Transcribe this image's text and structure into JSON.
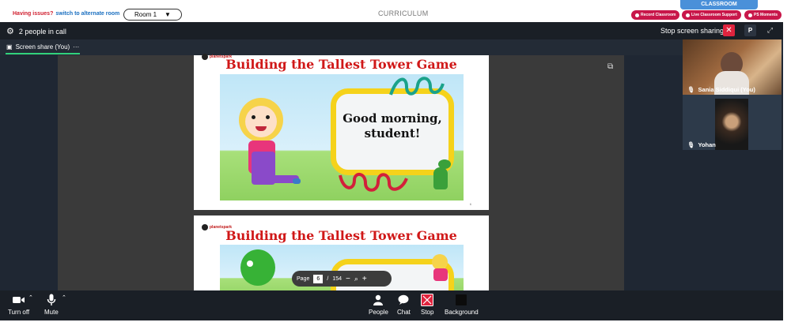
{
  "topbar": {
    "issue_text": "Having issues?",
    "alt_link": "switch to alternate room",
    "room_selected": "Room 1",
    "curriculum": "CURRICULUM",
    "classroom_tab": "CLASSROOM",
    "buttons": [
      "Record Classroom",
      "Live Classroom Support",
      "PS Moments"
    ]
  },
  "meeting": {
    "people_in_call": "2 people in call",
    "stop_sharing": "Stop screen sharing",
    "p_label": "P",
    "share_tab": "Screen share (You)",
    "share_more": "···"
  },
  "slides": [
    {
      "brand": "planetspark",
      "title": "Building the Tallest Tower Game",
      "greeting_line1": "Good morning,",
      "greeting_line2": "student!",
      "page_label": "6"
    },
    {
      "brand": "planetspark",
      "title": "Building the Tallest Tower Game"
    }
  ],
  "pager": {
    "label": "Page",
    "current": "6",
    "separator": "/",
    "total": "154"
  },
  "participants": [
    {
      "name": "Sania Siddiqui (You)"
    },
    {
      "name": "Yohan"
    }
  ],
  "toolbar": {
    "turn_off": "Turn off",
    "mute": "Mute",
    "people": "People",
    "chat": "Chat",
    "stop": "Stop",
    "background": "Background"
  },
  "colors": {
    "accent_red": "#e0243e",
    "share_underline": "#31d27c",
    "classroom_blue": "#4a90d9",
    "ps_red": "#c8174a"
  }
}
